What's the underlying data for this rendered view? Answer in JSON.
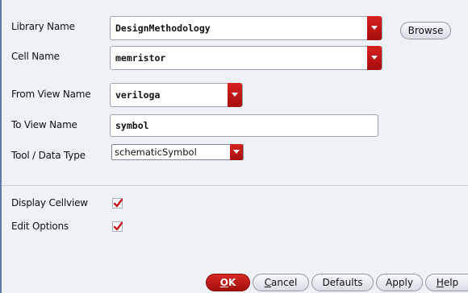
{
  "form": {
    "library_name": {
      "label": "Library Name",
      "value": "DesignMethodology"
    },
    "cell_name": {
      "label": "Cell Name",
      "value": "memristor"
    },
    "from_view_name": {
      "label": "From View Name",
      "value": "veriloga"
    },
    "to_view_name": {
      "label": "To View Name",
      "value": "symbol"
    },
    "tool_data_type": {
      "label": "Tool / Data Type",
      "value": "schematicSymbol"
    },
    "browse_label": "Browse",
    "display_cellview": {
      "label": "Display Cellview",
      "checked": true
    },
    "edit_options": {
      "label": "Edit Options",
      "checked": true
    }
  },
  "buttons": {
    "ok": {
      "label": "OK",
      "mnemonic": "O",
      "rest": "K"
    },
    "cancel": {
      "label": "Cancel",
      "mnemonic": "C",
      "rest": "ancel"
    },
    "defaults": {
      "label": "Defaults"
    },
    "apply": {
      "label": "Apply"
    },
    "help": {
      "label": "Help",
      "mnemonic": "H",
      "rest": "elp"
    }
  },
  "colors": {
    "accent_red": "#c4161c",
    "background": "#eef1f6"
  },
  "icons": {
    "dropdown": "chevron-down-icon",
    "check": "checkmark-icon"
  }
}
